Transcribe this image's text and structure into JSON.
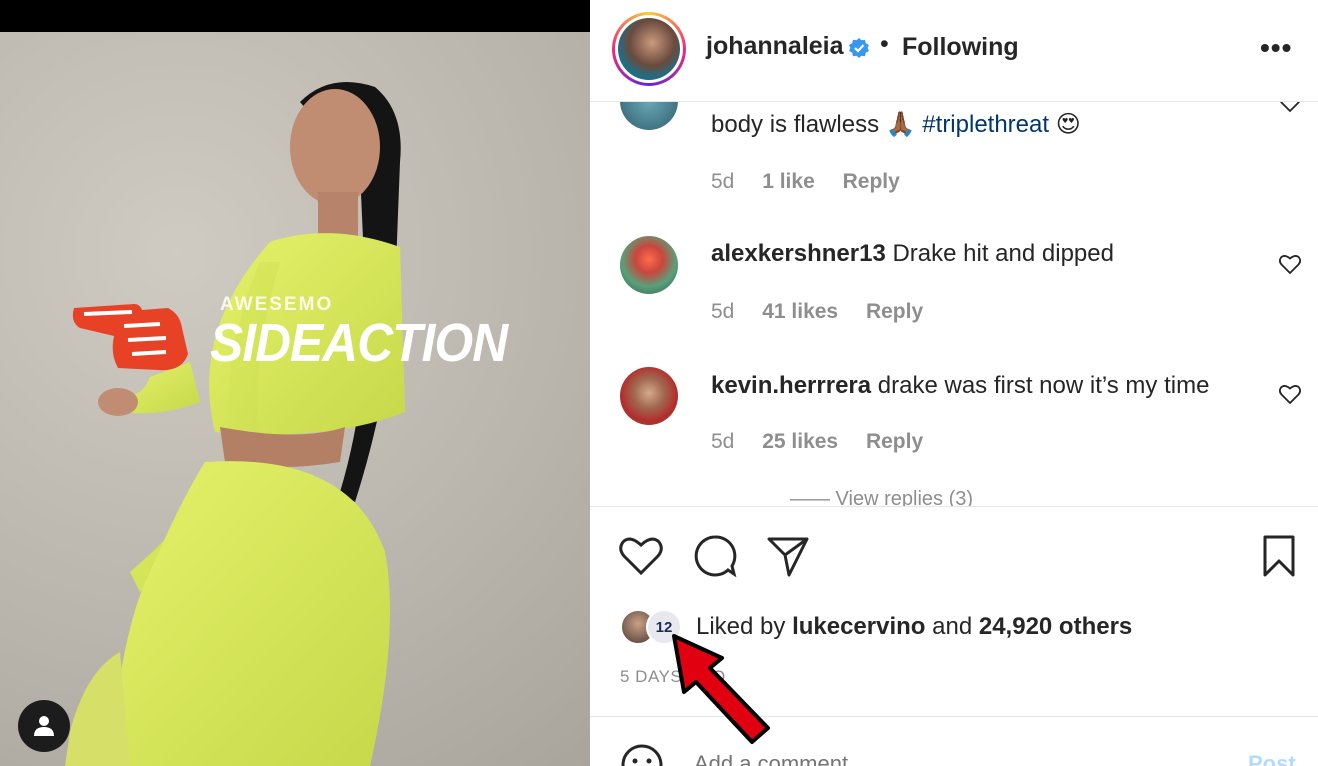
{
  "watermark": {
    "top": "AWESEMO",
    "main": "SIDEACTION"
  },
  "header": {
    "username": "johannaleia",
    "separator": "•",
    "follow_label": "Following",
    "more_label": "•••"
  },
  "comments": [
    {
      "username": "",
      "text": "body is flawless 🙏🏾",
      "hashtag": "#triplethreat",
      "emoji_end": "😍",
      "age": "5d",
      "likes": "1 like",
      "reply": "Reply"
    },
    {
      "username": "alexkershner13",
      "text": "Drake hit and dipped",
      "age": "5d",
      "likes": "41 likes",
      "reply": "Reply"
    },
    {
      "username": "kevin.herrrera",
      "text": "drake was first now it’s my time",
      "age": "5d",
      "likes": "25 likes",
      "reply": "Reply"
    }
  ],
  "view_replies": "—— View replies (3)",
  "likes": {
    "prefix": "Liked by",
    "user": "lukecervino",
    "conj": "and",
    "others": "24,920 others"
  },
  "post_date": "5 DAYS AGO",
  "comment_box": {
    "placeholder": "Add a comment…",
    "post_label": "Post"
  },
  "icons": [
    "verified-badge-icon",
    "more-options-icon",
    "heart-icon",
    "comment-icon",
    "share-icon",
    "bookmark-icon",
    "emoji-icon",
    "user-icon"
  ],
  "colors": {
    "accent_verified": "#3897f0",
    "link": "#00376b",
    "post_btn": "#b3dbff",
    "arrow": "#e0000f"
  }
}
